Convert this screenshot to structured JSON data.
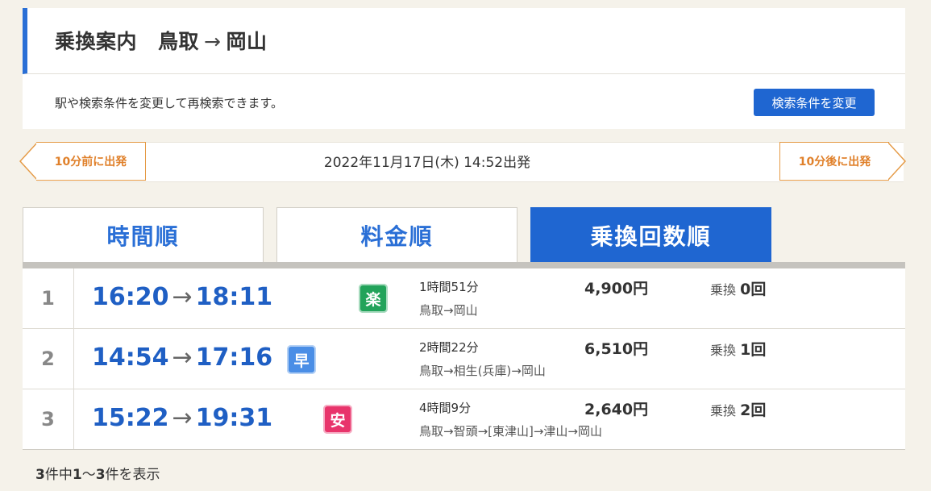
{
  "header": {
    "title": "乗換案内",
    "from": "鳥取",
    "arrow": "→",
    "to": "岡山",
    "note": "駅や検索条件を変更して再検索できます。",
    "change_button": "検索条件を変更"
  },
  "date_bar": {
    "prev_label": "10分前に出発",
    "datetime": "2022年11月17日(木) 14:52出発",
    "next_label": "10分後に出発",
    "accent_color": "#e59a45"
  },
  "tabs": [
    {
      "label": "時間順",
      "active": false
    },
    {
      "label": "料金順",
      "active": false
    },
    {
      "label": "乗換回数順",
      "active": true
    }
  ],
  "results": [
    {
      "rank": "1",
      "depart": "16:20",
      "arrow": "→",
      "arrive": "18:11",
      "badge": {
        "text": "楽",
        "color": "#22a35a",
        "name": "easy-badge"
      },
      "duration": "1時間51分",
      "route": "鳥取→岡山",
      "fare": "4,900円",
      "transfer_label": "乗換",
      "transfer_count": "0回"
    },
    {
      "rank": "2",
      "depart": "14:54",
      "arrow": "→",
      "arrive": "17:16",
      "badge": {
        "text": "早",
        "color": "#4a8ee6",
        "name": "fast-badge"
      },
      "duration": "2時間22分",
      "route": "鳥取→相生(兵庫)→岡山",
      "fare": "6,510円",
      "transfer_label": "乗換",
      "transfer_count": "1回"
    },
    {
      "rank": "3",
      "depart": "15:22",
      "arrow": "→",
      "arrive": "19:31",
      "badge": {
        "text": "安",
        "color": "#e8346b",
        "name": "cheap-badge"
      },
      "duration": "4時間9分",
      "route": "鳥取→智頭→[東津山]→津山→岡山",
      "fare": "2,640円",
      "transfer_label": "乗換",
      "transfer_count": "2回"
    }
  ],
  "footer": {
    "total": "3",
    "part1": "件中",
    "start": "1",
    "sep": "～",
    "end": "3",
    "part2": "件を表示"
  }
}
